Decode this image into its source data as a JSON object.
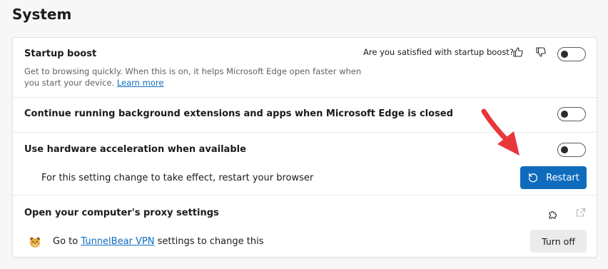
{
  "page": {
    "title": "System"
  },
  "settings": {
    "startup_boost": {
      "title": "Startup boost",
      "description": "Get to browsing quickly. When this is on, it helps Microsoft Edge open faster when you start your device.",
      "learn_more": "Learn more",
      "feedback_question": "Are you satisfied with startup boost?",
      "enabled": false
    },
    "background_apps": {
      "title": "Continue running background extensions and apps when Microsoft Edge is closed",
      "enabled": false
    },
    "hardware_acceleration": {
      "title": "Use hardware acceleration when available",
      "enabled": false,
      "restart_notice": "For this setting change to take effect, restart your browser",
      "restart_label": "Restart"
    },
    "proxy": {
      "title": "Open your computer's proxy settings",
      "extension_prefix": "Go to",
      "extension_name": "TunnelBear VPN",
      "extension_suffix": "settings to change this",
      "turn_off_label": "Turn off"
    }
  },
  "icons": {
    "thumbs_up": "thumbs-up-icon",
    "thumbs_down": "thumbs-down-icon",
    "restart": "restart-icon",
    "extension": "puzzle-icon",
    "external_link": "external-link-icon",
    "tunnelbear": "tunnelbear-logo",
    "annotation_arrow": "red-arrow"
  },
  "colors": {
    "accent": "#0f6cbd",
    "annotation": "#e8363b"
  }
}
